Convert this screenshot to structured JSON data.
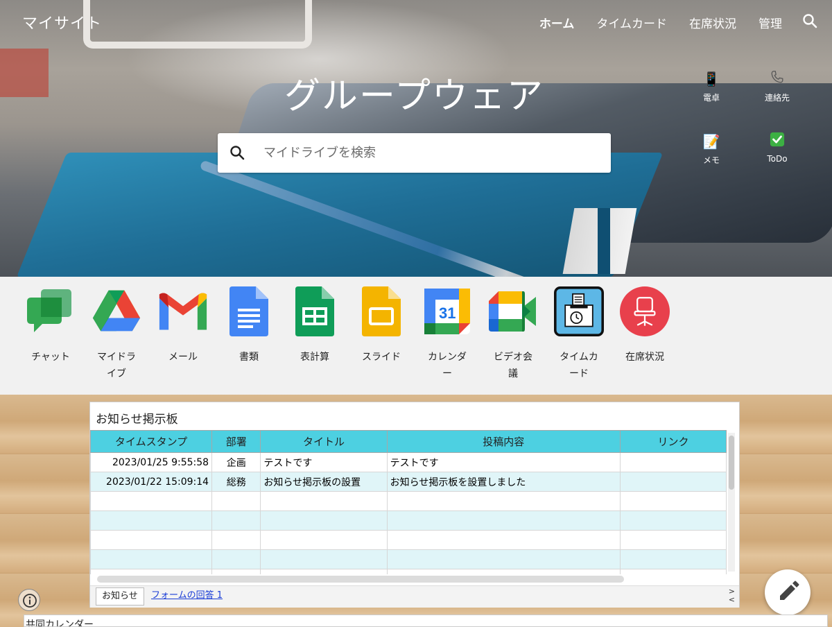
{
  "nav": {
    "site_title": "マイサイト",
    "links": [
      {
        "label": "ホーム",
        "active": true
      },
      {
        "label": "タイムカード",
        "active": false
      },
      {
        "label": "在席状況",
        "active": false
      },
      {
        "label": "管理",
        "active": false
      }
    ]
  },
  "hero": {
    "title": "グループウェア",
    "search_placeholder": "マイドライブを検索"
  },
  "quick_links": [
    {
      "label": "電卓",
      "icon": "mobile-phone-icon"
    },
    {
      "label": "連絡先",
      "icon": "telephone-icon"
    },
    {
      "label": "メモ",
      "icon": "memo-icon"
    },
    {
      "label": "ToDo",
      "icon": "check-mark-icon"
    }
  ],
  "apps": [
    {
      "label": "チャット",
      "icon": "google-chat-icon"
    },
    {
      "label": "マイドラ\nイブ",
      "icon": "google-drive-icon"
    },
    {
      "label": "メール",
      "icon": "gmail-icon"
    },
    {
      "label": "書類",
      "icon": "google-docs-icon"
    },
    {
      "label": "表計算",
      "icon": "google-sheets-icon"
    },
    {
      "label": "スライド",
      "icon": "google-slides-icon"
    },
    {
      "label": "カレンダ\nー",
      "icon": "google-calendar-icon",
      "calendar_day": "31"
    },
    {
      "label": "ビデオ会\n議",
      "icon": "google-meet-icon"
    },
    {
      "label": "タイムカ\nード",
      "icon": "time-clock-icon"
    },
    {
      "label": "在席状況",
      "icon": "chair-icon"
    }
  ],
  "board": {
    "title": "お知らせ掲示板",
    "columns": [
      "タイムスタンプ",
      "部署",
      "タイトル",
      "投稿内容",
      "リンク"
    ],
    "rows": [
      [
        "2023/01/25 9:55:58",
        "企画",
        "テストです",
        "テストです",
        ""
      ],
      [
        "2023/01/22 15:09:14",
        "総務",
        "お知らせ掲示板の設置",
        "お知らせ掲示板を設置しました",
        ""
      ],
      [
        "",
        "",
        "",
        "",
        ""
      ],
      [
        "",
        "",
        "",
        "",
        ""
      ],
      [
        "",
        "",
        "",
        "",
        ""
      ],
      [
        "",
        "",
        "",
        "",
        ""
      ],
      [
        "",
        "",
        "",
        "",
        ""
      ]
    ],
    "sheet_tabs": [
      "お知らせ",
      "フォームの回答 1"
    ],
    "arrows": [
      ">",
      "<"
    ]
  },
  "bottom_section_title": "共同カレンダー",
  "colors": {
    "header_cyan": "#4dd0e1",
    "row_alt": "#e0f5f8",
    "chat_green": "#34a853",
    "chair_red": "#e8404c",
    "timecard_blue": "#5db7e6"
  }
}
